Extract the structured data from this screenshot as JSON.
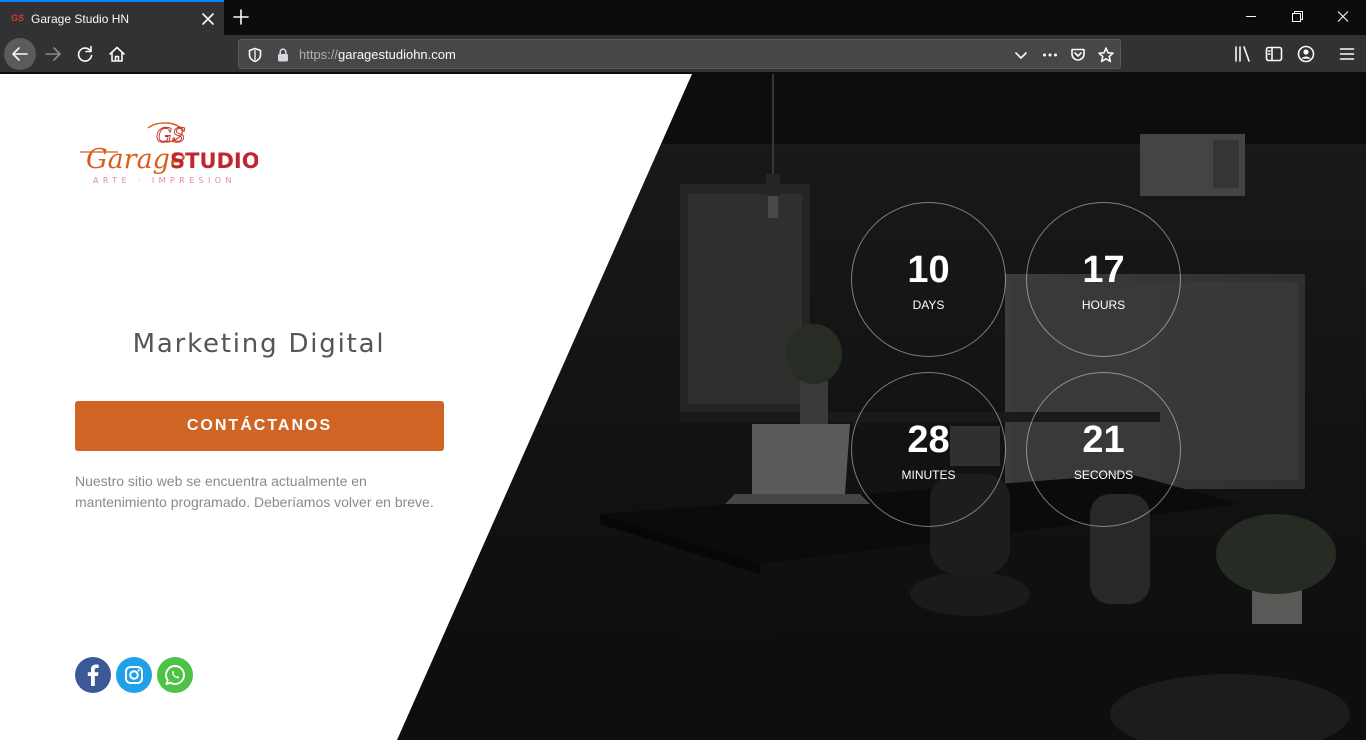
{
  "browser": {
    "tab_title": "Garage Studio HN",
    "tab_favicon": "GS",
    "url_protocol": "https://",
    "url_host": "garagestudiohn.com"
  },
  "icons": {
    "tab_close": "close-icon",
    "new_tab": "plus-icon",
    "back": "arrow-left-icon",
    "forward": "arrow-right-icon",
    "reload": "reload-icon",
    "home": "home-icon",
    "shield": "shield-icon",
    "lock": "lock-icon",
    "dropdown": "chevron-down-icon",
    "more": "ellipsis-icon",
    "pocket": "pocket-icon",
    "bookmark": "star-icon",
    "library": "library-icon",
    "sidebar": "sidebar-icon",
    "account": "account-icon",
    "menu": "hamburger-icon"
  },
  "colors": {
    "accent": "#cf6424",
    "brand_red": "#c0272d",
    "brand_orange": "#d85e1e",
    "facebook": "#3b5998",
    "instagram": "#1ea1e9",
    "whatsapp": "#4dc247"
  },
  "logo": {
    "initials": "GS",
    "script": "Garage",
    "bold": "STUDIO",
    "sub": "ARTE · IMPRESION"
  },
  "hero": {
    "tagline": "Marketing Digital",
    "cta_label": "CONTÁCTANOS",
    "notice": "Nuestro sitio web se encuentra actualmente en mantenimiento programado. Deberíamos volver en breve."
  },
  "countdown": [
    {
      "value": "10",
      "label": "DAYS"
    },
    {
      "value": "17",
      "label": "HOURS"
    },
    {
      "value": "28",
      "label": "MINUTES"
    },
    {
      "value": "21",
      "label": "SECONDS"
    }
  ],
  "social": [
    "facebook-icon",
    "instagram-icon",
    "whatsapp-icon"
  ]
}
